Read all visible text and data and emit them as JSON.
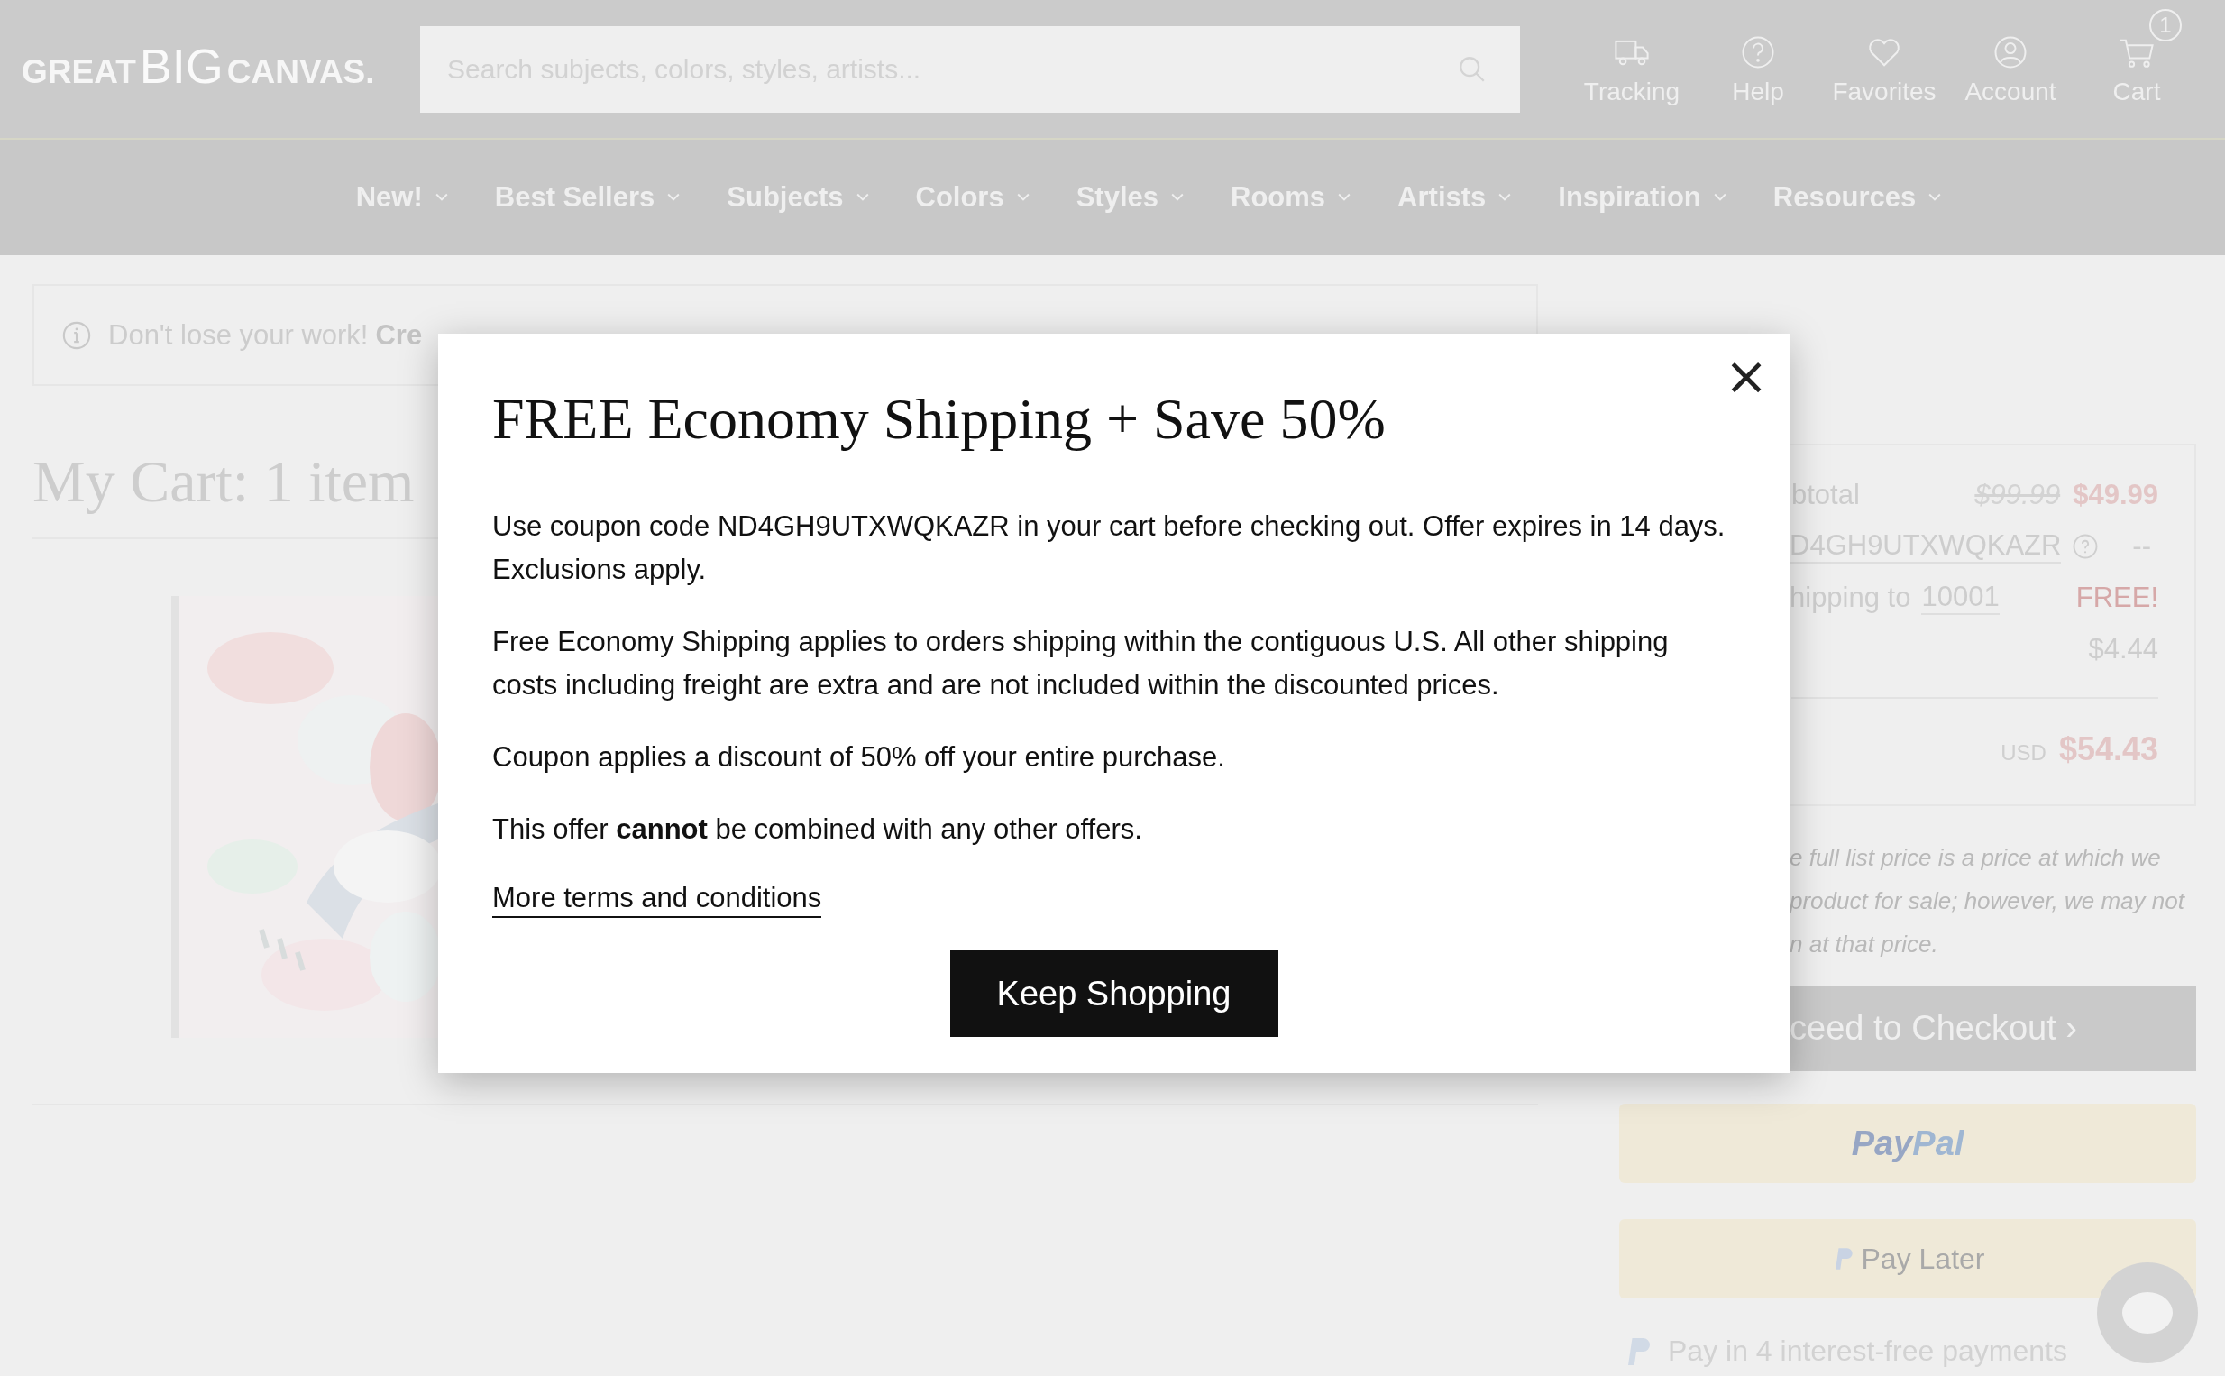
{
  "header": {
    "logo": [
      "GREAT",
      "BIG",
      "CANVAS."
    ],
    "search": {
      "placeholder": "Search subjects, colors, styles, artists..."
    },
    "actions": [
      {
        "kind": "truck",
        "label": "Tracking"
      },
      {
        "kind": "help",
        "label": "Help"
      },
      {
        "kind": "heart",
        "label": "Favorites"
      },
      {
        "kind": "user",
        "label": "Account"
      },
      {
        "kind": "cart",
        "label": "Cart",
        "badge": "1"
      }
    ]
  },
  "nav": [
    "New!",
    "Best Sellers",
    "Subjects",
    "Colors",
    "Styles",
    "Rooms",
    "Artists",
    "Inspiration",
    "Resources"
  ],
  "notice": {
    "text": "Don't lose your work!",
    "link": "Cre"
  },
  "cart_title": "My Cart: 1 item",
  "summary": {
    "subtotal_label": "btotal",
    "list_price": "$99.99",
    "price": "$49.99",
    "coupon": "D4GH9UTXWQKAZR",
    "coupon_value": "--",
    "shipping_label": "hipping to",
    "zip": "10001",
    "shipping_value": "FREE!",
    "tax_value": "$4.44",
    "currency": "USD",
    "total": "$54.43",
    "disclaimer": [
      "e full list price is a price at which we",
      "product for sale; however, we may not",
      "n at that price."
    ],
    "checkout": "ceed to Checkout ›",
    "paypal": [
      "Pay",
      "Pal"
    ],
    "pay_later": "Pay Later",
    "pay_in_4": "Pay in 4 interest-free payments"
  },
  "modal": {
    "title": "FREE Economy Shipping + Save 50%",
    "paragraphs": [
      "Use coupon code ND4GH9UTXWQKAZR in your cart before checking out. Offer expires in 14 days. Exclusions apply.",
      "Free Economy Shipping applies to orders shipping within the contiguous U.S. All other shipping costs including freight are extra and are not included within the discounted prices.",
      "Coupon applies a discount of 50% off your entire purchase.",
      "This offer **cannot** be combined with any other offers."
    ],
    "link": "More terms and conditions",
    "close": "×",
    "button": "Keep Shopping"
  }
}
